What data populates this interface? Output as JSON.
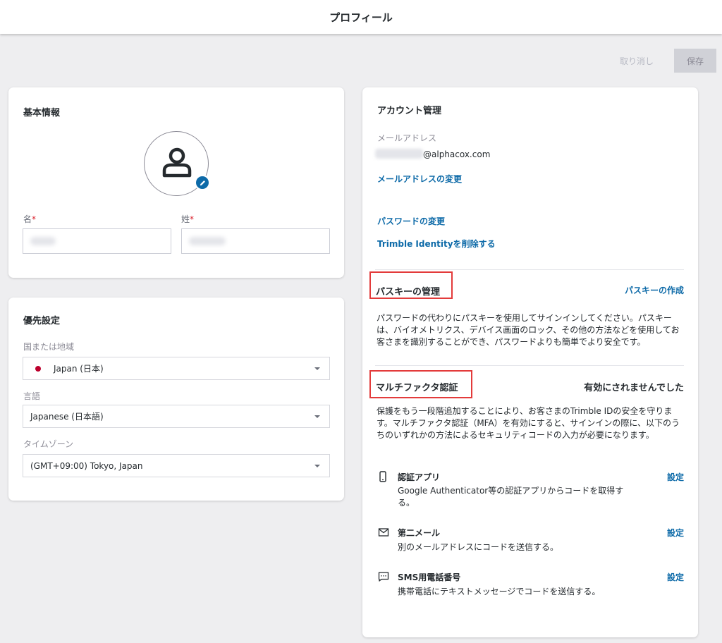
{
  "header": {
    "title": "プロフィール"
  },
  "actions": {
    "cancel_label": "取り消し",
    "save_label": "保存"
  },
  "basic_info": {
    "title": "基本情報",
    "first_name": {
      "label": "名",
      "required_mark": "*"
    },
    "last_name": {
      "label": "姓",
      "required_mark": "*"
    }
  },
  "preferences": {
    "title": "優先設定",
    "country": {
      "label": "国または地域",
      "value": "Japan (日本)"
    },
    "language": {
      "label": "言語",
      "value": "Japanese (日本語)"
    },
    "timezone": {
      "label": "タイムゾーン",
      "value": "(GMT+09:00) Tokyo, Japan"
    }
  },
  "account": {
    "title": "アカウント管理",
    "email_label": "メールアドレス",
    "email_domain": "@alphacox.com",
    "change_email": "メールアドレスの変更",
    "change_password": "パスワードの変更",
    "delete_identity": "Trimble Identityを削除する"
  },
  "passkey": {
    "title": "パスキーの管理",
    "create_link": "パスキーの作成",
    "description": "パスワードの代わりにパスキーを使用してサインインしてください。パスキーは、バイオメトリクス、デバイス画面のロック、その他の方法などを使用してお客さまを識別することができ、パスワードよりも簡単でより安全です。"
  },
  "mfa": {
    "title": "マルチファクタ認証",
    "status": "有効にされませんでした",
    "description": "保護をもう一段階追加することにより、お客さまのTrimble IDの安全を守ります。マルチファクタ認証（MFA）を有効にすると、サインインの際に、以下のうちのいずれかの方法によるセキュリティコードの入力が必要になります。",
    "methods": [
      {
        "icon": "phone-icon",
        "title": "認証アプリ",
        "description": "Google Authenticator等の認証アプリからコードを取得する。",
        "action": "設定"
      },
      {
        "icon": "mail-icon",
        "title": "第二メール",
        "description": "別のメールアドレスにコードを送信する。",
        "action": "設定"
      },
      {
        "icon": "chat-icon",
        "title": "SMS用電話番号",
        "description": "携帯電話にテキストメッセージでコードを送信する。",
        "action": "設定"
      }
    ]
  },
  "colors": {
    "accent": "#0d6aa8",
    "highlight": "#e33b3b",
    "required": "#da212c",
    "flag": "#bc002d"
  }
}
